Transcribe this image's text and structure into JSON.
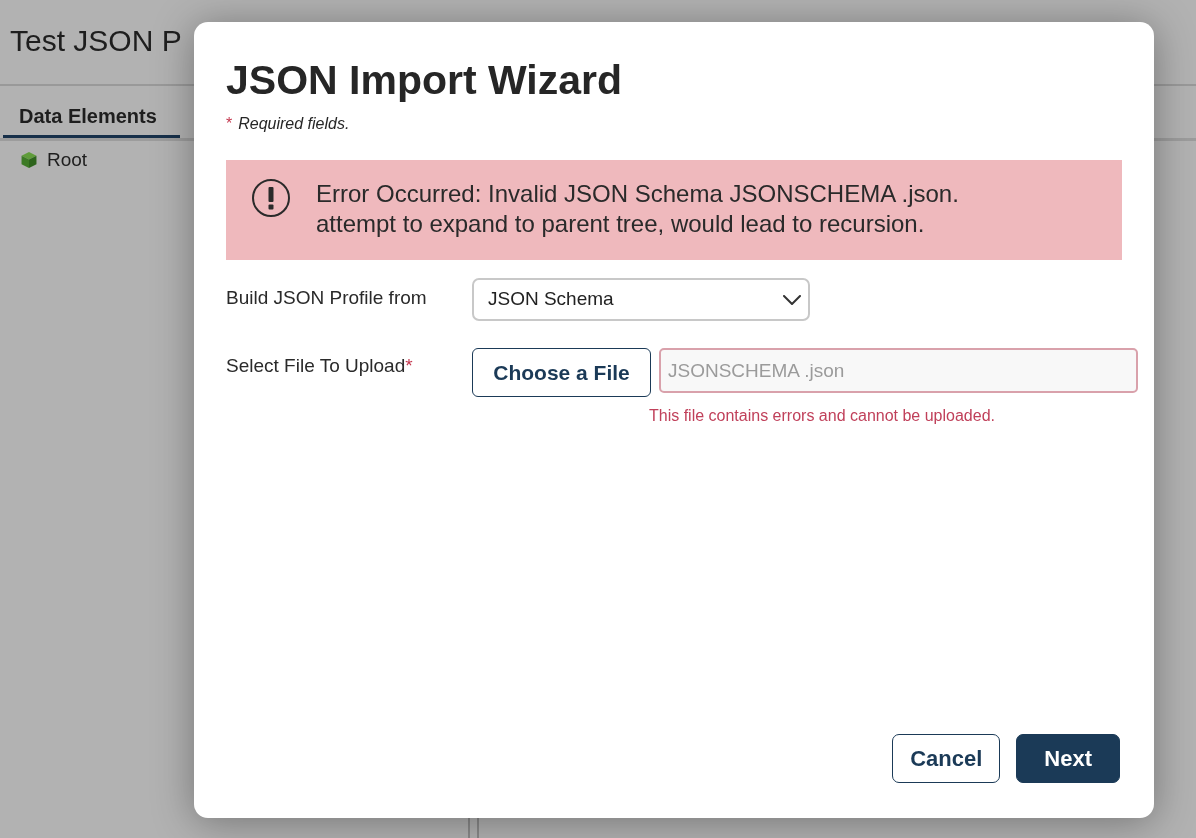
{
  "page": {
    "title": "Test JSON P",
    "tabs": [
      {
        "label": "Data Elements",
        "selected": true
      }
    ],
    "tree": [
      {
        "label": "Root"
      }
    ]
  },
  "dialog": {
    "title": "JSON Import Wizard",
    "required_note": {
      "marker": "*",
      "text": "Required fields."
    },
    "alert": {
      "kind": "error",
      "message": "Error Occurred: Invalid JSON Schema JSONSCHEMA .json.\nattempt to expand to parent tree, would lead to recursion."
    },
    "fields": [
      {
        "kind": "select",
        "label": "Build JSON Profile from",
        "value": "JSON Schema",
        "invalid": false
      },
      {
        "kind": "file",
        "label": "Select File To Upload",
        "required_marker": "*",
        "button": "Choose a File",
        "value": "JSONSCHEMA .json",
        "readonly": true,
        "invalid": true,
        "error": "This file contains errors and cannot be uploaded."
      }
    ],
    "buttons": [
      {
        "label": "Cancel",
        "kind": "secondary"
      },
      {
        "label": "Next",
        "kind": "primary"
      }
    ]
  }
}
